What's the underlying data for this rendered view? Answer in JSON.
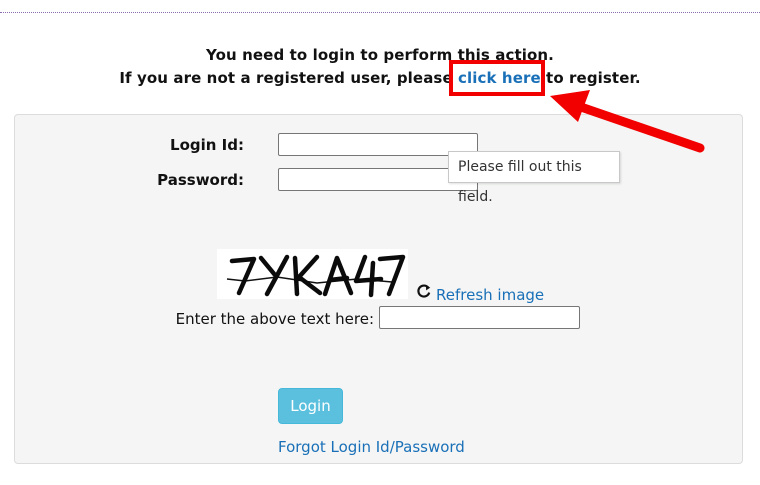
{
  "message": {
    "line1": "You need to login to perform this action.",
    "line2_prefix": "If you are not a registered user, please ",
    "register_link": "click here",
    "line2_suffix": " to register."
  },
  "form": {
    "login_id_label": "Login Id:",
    "login_id_value": "",
    "password_label": "Password:",
    "password_value": "",
    "tooltip": "Please fill out this field.",
    "captcha_text": "7YKA47",
    "refresh_label": "Refresh image",
    "captcha_prompt": "Enter the above text here:",
    "captcha_value": "",
    "login_button": "Login",
    "forgot_link": "Forgot Login Id/Password"
  },
  "colors": {
    "link": "#1a70b8",
    "button": "#5bc0de",
    "highlight": "#f20000"
  }
}
